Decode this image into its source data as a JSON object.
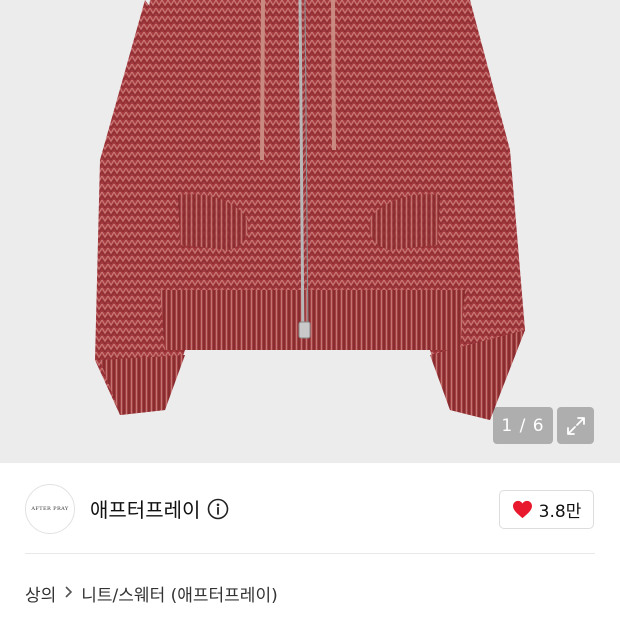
{
  "gallery": {
    "counter": "1 / 6",
    "expand_icon": "expand-arrows-icon",
    "product_colors": {
      "knit": "#a33a3f",
      "knit_light": "#c45a5e",
      "knit_dark": "#7c2429",
      "background": "#ececec"
    }
  },
  "brand": {
    "logo_text": "AFTER PRAY",
    "name": "애프터프레이",
    "info_icon": "info-circle-icon"
  },
  "like": {
    "icon": "heart-icon",
    "count": "3.8만",
    "color": "#e8192c"
  },
  "breadcrumb": {
    "items": [
      "상의",
      "니트/스웨터 (애프터프레이)"
    ],
    "separator_icon": "chevron-right-icon"
  }
}
